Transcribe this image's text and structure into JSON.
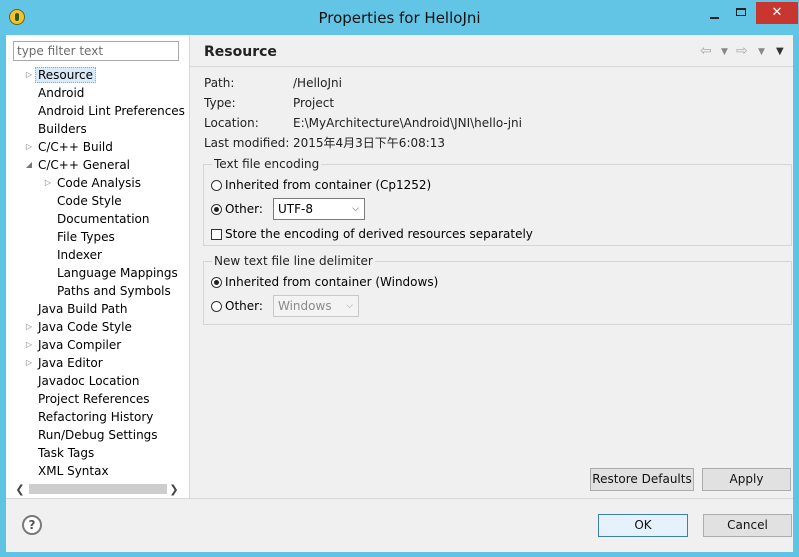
{
  "window": {
    "title": "Properties for HelloJni"
  },
  "filter": {
    "placeholder": "type filter text"
  },
  "tree": [
    {
      "label": "Resource",
      "indent": 0,
      "arrow": "right",
      "selected": true
    },
    {
      "label": "Android",
      "indent": 0,
      "arrow": ""
    },
    {
      "label": "Android Lint Preferences",
      "indent": 0,
      "arrow": ""
    },
    {
      "label": "Builders",
      "indent": 0,
      "arrow": ""
    },
    {
      "label": "C/C++ Build",
      "indent": 0,
      "arrow": "right"
    },
    {
      "label": "C/C++ General",
      "indent": 0,
      "arrow": "down"
    },
    {
      "label": "Code Analysis",
      "indent": 1,
      "arrow": "right"
    },
    {
      "label": "Code Style",
      "indent": 1,
      "arrow": ""
    },
    {
      "label": "Documentation",
      "indent": 1,
      "arrow": ""
    },
    {
      "label": "File Types",
      "indent": 1,
      "arrow": ""
    },
    {
      "label": "Indexer",
      "indent": 1,
      "arrow": ""
    },
    {
      "label": "Language Mappings",
      "indent": 1,
      "arrow": ""
    },
    {
      "label": "Paths and Symbols",
      "indent": 1,
      "arrow": ""
    },
    {
      "label": "Java Build Path",
      "indent": 0,
      "arrow": ""
    },
    {
      "label": "Java Code Style",
      "indent": 0,
      "arrow": "right"
    },
    {
      "label": "Java Compiler",
      "indent": 0,
      "arrow": "right"
    },
    {
      "label": "Java Editor",
      "indent": 0,
      "arrow": "right"
    },
    {
      "label": "Javadoc Location",
      "indent": 0,
      "arrow": ""
    },
    {
      "label": "Project References",
      "indent": 0,
      "arrow": ""
    },
    {
      "label": "Refactoring History",
      "indent": 0,
      "arrow": ""
    },
    {
      "label": "Run/Debug Settings",
      "indent": 0,
      "arrow": ""
    },
    {
      "label": "Task Tags",
      "indent": 0,
      "arrow": ""
    },
    {
      "label": "XML Syntax",
      "indent": 0,
      "arrow": ""
    }
  ],
  "page": {
    "title": "Resource",
    "path_label": "Path:",
    "path": "/HelloJni",
    "type_label": "Type:",
    "type": "Project",
    "location_label": "Location:",
    "location": "E:\\MyArchitecture\\Android\\JNI\\hello-jni",
    "modified_label": "Last modified:",
    "modified": "2015年4月3日下午6:08:13"
  },
  "encoding": {
    "title": "Text file encoding",
    "inherited_label": "Inherited from container (Cp1252)",
    "other_label": "Other:",
    "other_value": "UTF-8",
    "selected": "other",
    "store_label": "Store the encoding of derived resources separately",
    "store_checked": false
  },
  "delimiter": {
    "title": "New text file line delimiter",
    "inherited_label": "Inherited from container (Windows)",
    "other_label": "Other:",
    "other_value": "Windows",
    "selected": "inherited"
  },
  "buttons": {
    "restore": "Restore Defaults",
    "apply": "Apply",
    "ok": "OK",
    "cancel": "Cancel",
    "help": "?"
  },
  "icons": {
    "app": "eclipse-icon",
    "minimize": "minimize-icon",
    "maximize": "maximize-icon",
    "close": "close-icon",
    "back": "back-arrow-icon",
    "forward": "forward-arrow-icon",
    "menu": "view-menu-icon",
    "help": "help-icon"
  }
}
